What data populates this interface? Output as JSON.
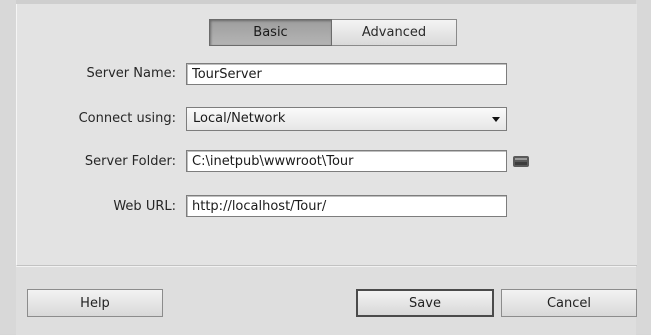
{
  "tabs": {
    "basic": "Basic",
    "advanced": "Advanced",
    "active": "Basic"
  },
  "form": {
    "server_name": {
      "label": "Server Name:",
      "value": "TourServer"
    },
    "connect_using": {
      "label": "Connect using:",
      "value": "Local/Network"
    },
    "server_folder": {
      "label": "Server Folder:",
      "value": "C:\\inetpub\\wwwroot\\Tour"
    },
    "web_url": {
      "label": "Web URL:",
      "value": "http://localhost/Tour/"
    }
  },
  "icons": {
    "browse": "folder-browse-icon",
    "dropdown": "chevron-down-icon"
  },
  "buttons": {
    "help": "Help",
    "save": "Save",
    "cancel": "Cancel"
  }
}
